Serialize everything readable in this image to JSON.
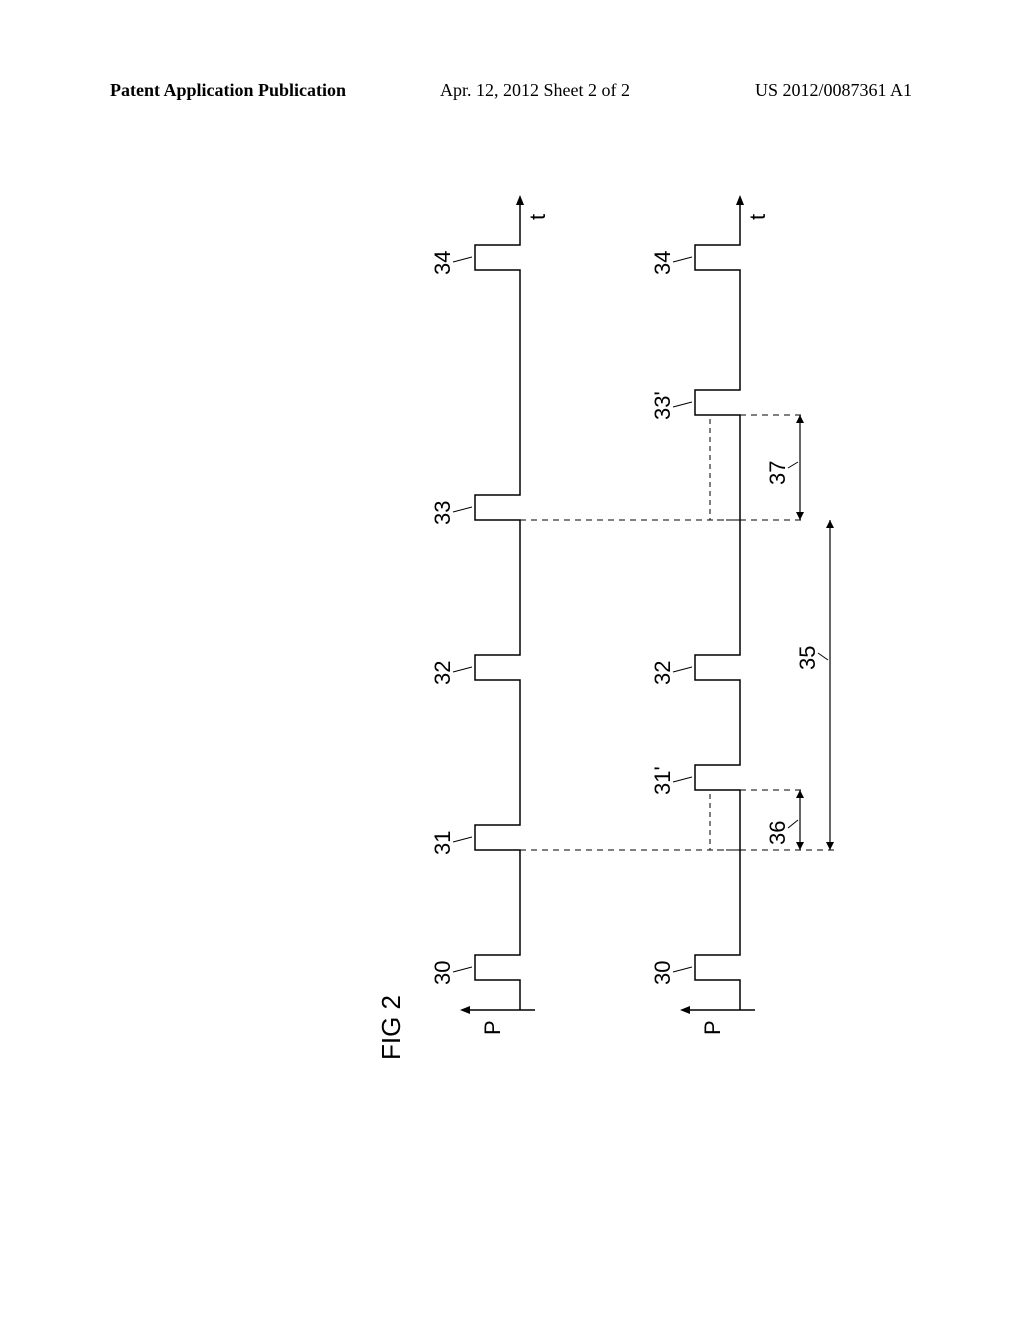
{
  "header": {
    "left": "Patent Application Publication",
    "center": "Apr. 12, 2012  Sheet 2 of 2",
    "right": "US 2012/0087361 A1"
  },
  "figure": {
    "title": "FIG 2",
    "axisLabel": "P",
    "timeLabel": "t",
    "topPulses": {
      "p30": "30",
      "p31": "31",
      "p32": "32",
      "p33": "33",
      "p34": "34"
    },
    "bottomPulses": {
      "p30": "30",
      "p31p": "31'",
      "p32": "32",
      "p33p": "33'",
      "p34": "34"
    },
    "spans": {
      "s35": "35",
      "s36": "36",
      "s37": "37"
    }
  }
}
